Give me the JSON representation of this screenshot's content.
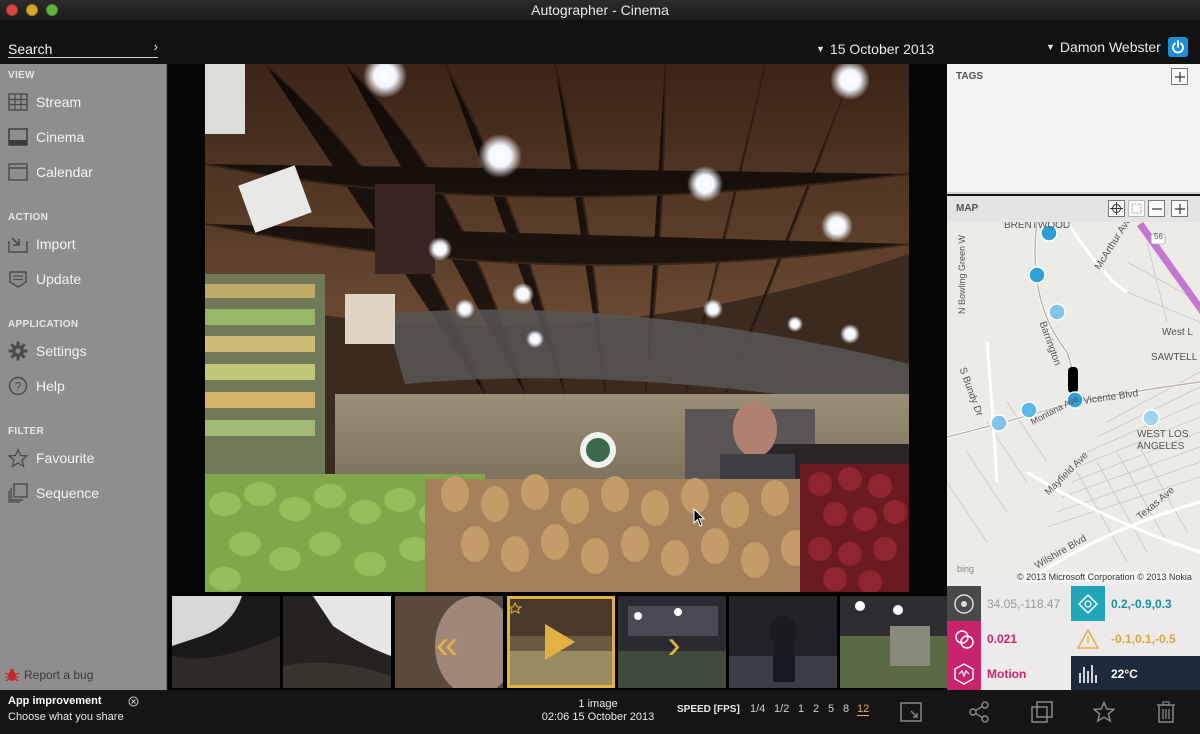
{
  "window": {
    "title": "Autographer - Cinema",
    "title_arrow": "↓"
  },
  "search": {
    "placeholder": "Search",
    "go": "›"
  },
  "date": {
    "selected": "15 October 2013"
  },
  "user": {
    "name": "Damon Webster"
  },
  "sidebar": {
    "sections": [
      {
        "title": "VIEW",
        "items": [
          {
            "label": "Stream",
            "icon": "grid-icon"
          },
          {
            "label": "Cinema",
            "icon": "cinema-icon"
          },
          {
            "label": "Calendar",
            "icon": "calendar-icon"
          }
        ]
      },
      {
        "title": "ACTION",
        "items": [
          {
            "label": "Import",
            "icon": "import-icon"
          },
          {
            "label": "Update",
            "icon": "update-icon"
          }
        ]
      },
      {
        "title": "APPLICATION",
        "items": [
          {
            "label": "Settings",
            "icon": "gear-icon"
          },
          {
            "label": "Help",
            "icon": "help-icon"
          }
        ]
      },
      {
        "title": "FILTER",
        "items": [
          {
            "label": "Favourite",
            "icon": "star-icon"
          },
          {
            "label": "Sequence",
            "icon": "sequence-icon"
          }
        ]
      }
    ],
    "report_bug": "Report a bug"
  },
  "tags": {
    "title": "TAGS"
  },
  "map": {
    "title": "MAP",
    "credit": "© 2013 Microsoft Corporation © 2013 Nokia",
    "labels": {
      "brentwood": "BRENTWOOD",
      "mcarthur": "McArthur Ave",
      "barrington": "Barrington",
      "west_la": "West L",
      "sawtell": "SAWTELL",
      "vicente": "Vicente Blvd",
      "bundy": "S Bundy Dr",
      "montana": "Montana Ave",
      "west_los_angeles": "WEST LOS ANGELES",
      "mayfield": "Mayfield Ave",
      "texas": "Texas Ave",
      "wilshire": "Wilshire Blvd",
      "bowling": "N Bowling Green W",
      "route": "56",
      "bing": "bing"
    }
  },
  "sensors": {
    "gps": "34.05,-118.47",
    "accelerometer": "0.2,-0.9,0.3",
    "light": "0.021",
    "magnetometer": "-0.1,0.1,-0.5",
    "motion": "Motion",
    "temperature": "22°C"
  },
  "colors": {
    "accent_gold": "#e3b044",
    "teal": "#21a5b8",
    "magenta": "#c8246e",
    "power_blue": "#1e8fd6"
  },
  "notice": {
    "title": "App improvement",
    "text": "Choose what you share"
  },
  "status": {
    "count": "1 image",
    "time": "02:06 15 October 2013"
  },
  "speed": {
    "label": "SPEED [FPS]",
    "options": [
      "1/4",
      "1/2",
      "1",
      "2",
      "5",
      "8",
      "12"
    ],
    "selected": "12"
  }
}
